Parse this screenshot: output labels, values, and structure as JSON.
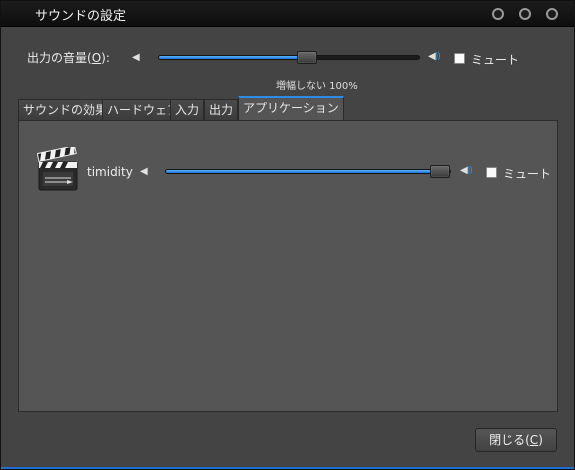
{
  "window": {
    "title": "サウンドの設定"
  },
  "output_volume": {
    "label_prefix": "出力の音量(",
    "label_mnemonic": "O",
    "label_suffix": "):",
    "level_fraction": 0.57,
    "amplification_text": "増幅しない 100%",
    "mute_label": "ミュート",
    "mute_checked": false
  },
  "tabs": [
    {
      "label": "サウンドの効果",
      "active": false
    },
    {
      "label": "ハードウェア",
      "active": false
    },
    {
      "label": "入力",
      "active": false
    },
    {
      "label": "出力",
      "active": false
    },
    {
      "label": "アプリケーション",
      "active": true
    }
  ],
  "applications": [
    {
      "name": "timidity",
      "icon": "clapperboard-icon",
      "level_fraction": 0.96,
      "mute_label": "ミュート",
      "mute_checked": false
    }
  ],
  "footer": {
    "close_prefix": "閉じる(",
    "close_mnemonic": "C",
    "close_suffix": ")"
  },
  "colors": {
    "accent": "#2b8de8",
    "background": "#444444",
    "panel": "#555555"
  }
}
